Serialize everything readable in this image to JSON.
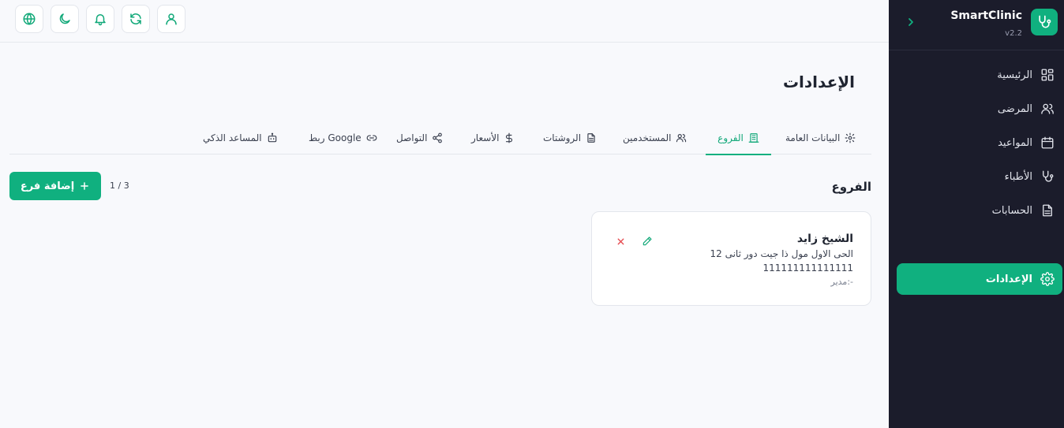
{
  "sidebar": {
    "title": "SmartClinic",
    "version": "v2.2",
    "items": [
      {
        "label": "الرئيسية",
        "icon": "dashboard-icon"
      },
      {
        "label": "المرضى",
        "icon": "users-icon"
      },
      {
        "label": "المواعيد",
        "icon": "calendar-icon"
      },
      {
        "label": "الأطباء",
        "icon": "stethoscope-icon"
      },
      {
        "label": "الحسابات",
        "icon": "document-icon"
      },
      {
        "label": "الإعدادات",
        "icon": "gear-icon",
        "active": true
      }
    ]
  },
  "topbar": {
    "buttons": [
      "globe-icon",
      "moon-icon",
      "bell-icon",
      "refresh-icon",
      "user-icon"
    ]
  },
  "page": {
    "title": "الإعدادات"
  },
  "tabs": [
    {
      "label": "البيانات العامة",
      "icon": "gear-icon"
    },
    {
      "label": "الفروع",
      "icon": "building-icon",
      "active": true
    },
    {
      "label": "المستخدمين",
      "icon": "users-icon"
    },
    {
      "label": "الروشتات",
      "icon": "document-icon"
    },
    {
      "label": "الأسعار",
      "icon": "dollar-icon"
    },
    {
      "label": "التواصل",
      "icon": "share-icon"
    },
    {
      "label": "ربط Google",
      "icon": "link-icon"
    },
    {
      "label": "المساعد الذكي",
      "icon": "bot-icon"
    }
  ],
  "branches": {
    "title": "الفروع",
    "counter": "1 / 3",
    "add_label": "إضافة فرع",
    "items": [
      {
        "name": "الشيخ زايد",
        "address": "الحى الاول مول ذا جيت دور ثانى 12",
        "phone": "111111111111111",
        "manager": "مدير:-"
      }
    ]
  },
  "colors": {
    "accent": "#10b07f",
    "sidebar_bg": "#1b1c2b",
    "danger": "#e5484d"
  }
}
